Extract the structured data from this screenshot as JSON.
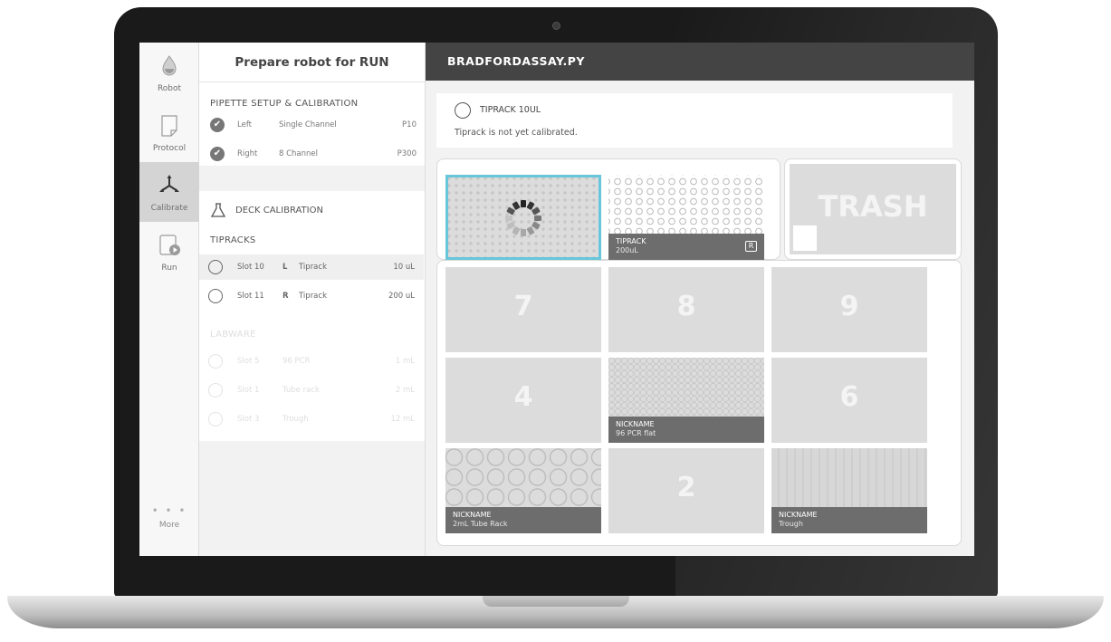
{
  "nav": {
    "items": [
      {
        "label": "Robot",
        "icon": "robot-drop-icon"
      },
      {
        "label": "Protocol",
        "icon": "document-icon"
      },
      {
        "label": "Calibrate",
        "icon": "calibrate-axes-icon"
      },
      {
        "label": "Run",
        "icon": "run-play-icon"
      }
    ],
    "more_dots": "• • •",
    "more_label": "More"
  },
  "panel": {
    "title": "Prepare robot for RUN",
    "pipette_section": "PIPETTE SETUP & CALIBRATION",
    "pipettes": [
      {
        "side": "Left",
        "type": "Single Channel",
        "model": "P10"
      },
      {
        "side": "Right",
        "type": "8 Channel",
        "model": "P300"
      }
    ],
    "deck_calibration": "DECK CALIBRATION",
    "tipracks_title": "TIPRACKS",
    "tipracks": [
      {
        "slot": "Slot 10",
        "side": "L",
        "name": "Tiprack",
        "volume": "10 uL"
      },
      {
        "slot": "Slot 11",
        "side": "R",
        "name": "Tiprack",
        "volume": "200 uL"
      }
    ],
    "labware_title": "LABWARE",
    "labware": [
      {
        "slot": "Slot 5",
        "name": "96 PCR",
        "volume": "1 mL"
      },
      {
        "slot": "Slot 1",
        "name": "Tube rack",
        "volume": "2 mL"
      },
      {
        "slot": "Slot 3",
        "name": "Trough",
        "volume": "12 mL"
      }
    ]
  },
  "main": {
    "title": "BRADFORDASSAY.PY",
    "alert_title": "TIPRACK 10UL",
    "alert_message": "Tiprack is not yet calibrated.",
    "trash": "TRASH",
    "tiprack_label": "TIPRACK",
    "tiprack_sub": "200uL",
    "tiprack_badge": "R",
    "slot7": "7",
    "slot8": "8",
    "slot9": "9",
    "slot4": "4",
    "slot6": "6",
    "slot2": "2",
    "pcr_label": "NICKNAME",
    "pcr_sub": "96 PCR flat",
    "tube_label": "NICKNAME",
    "tube_sub": "2mL Tube Rack",
    "trough_label": "NICKNAME",
    "trough_sub": "Trough",
    "selected_color": "#67c6d9"
  }
}
